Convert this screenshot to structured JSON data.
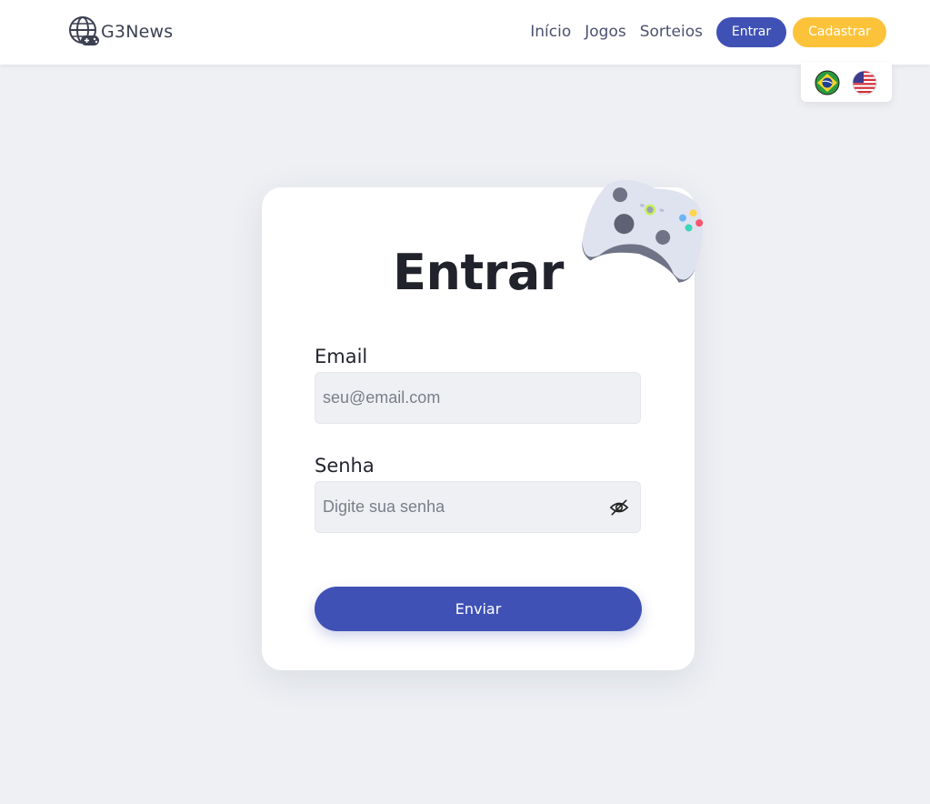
{
  "header": {
    "brand": "G3News",
    "nav": [
      "Início",
      "Jogos",
      "Sorteios"
    ],
    "login_label": "Entrar",
    "signup_label": "Cadastrar",
    "languages": [
      "pt-BR",
      "en-US"
    ]
  },
  "login_form": {
    "title": "Entrar",
    "email_label": "Email",
    "email_placeholder": "seu@email.com",
    "email_value": "",
    "password_label": "Senha",
    "password_placeholder": "Digite sua senha",
    "password_value": "",
    "password_toggle_icon": "eye-slash-icon",
    "submit_label": "Enviar"
  },
  "decor": {
    "illustration": "gamepad-icon"
  },
  "colors": {
    "primary": "#3f51b5",
    "accent": "#fcc33a",
    "background": "#eef0f4"
  }
}
